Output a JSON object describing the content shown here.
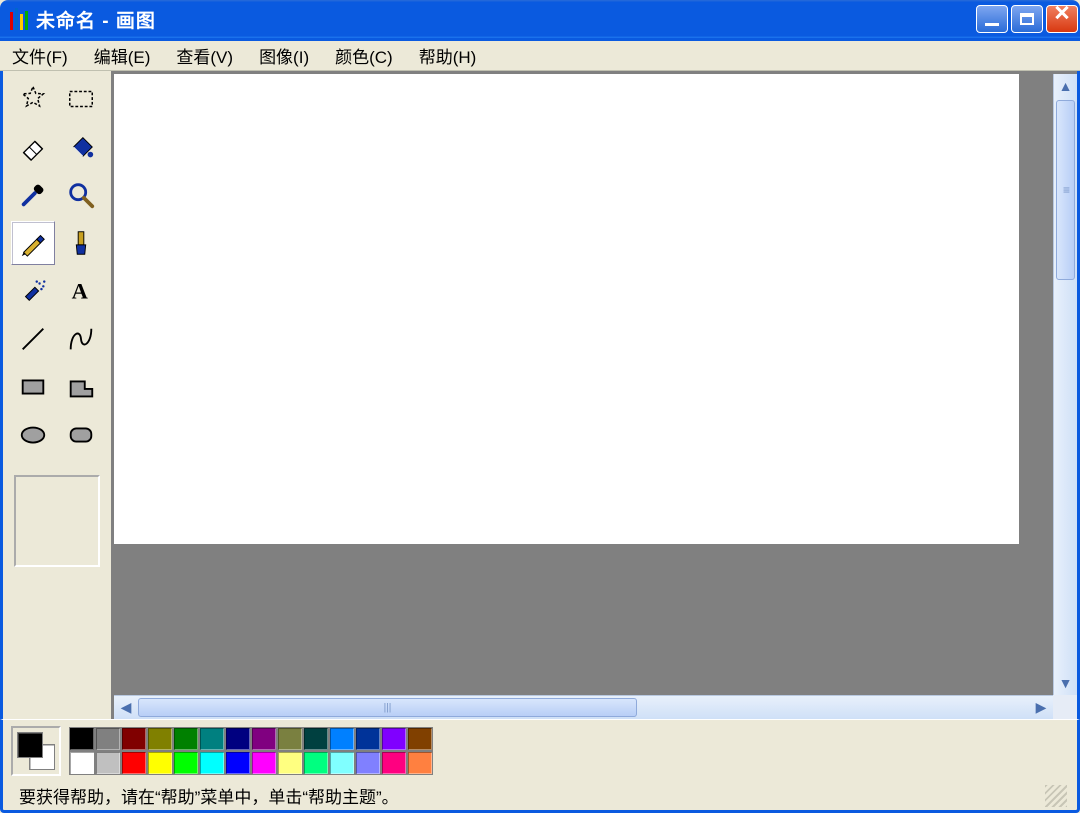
{
  "window": {
    "title": "未命名 - 画图"
  },
  "menu": {
    "file": "文件(F)",
    "edit": "编辑(E)",
    "view": "查看(V)",
    "image": "图像(I)",
    "color": "颜色(C)",
    "help": "帮助(H)"
  },
  "tools": {
    "freeform_select": "free-form-select",
    "rect_select": "rectangle-select",
    "eraser": "eraser",
    "fill": "fill-bucket",
    "picker": "color-picker",
    "magnifier": "magnifier",
    "pencil": "pencil",
    "brush": "brush",
    "airbrush": "airbrush",
    "text": "text",
    "line": "line",
    "curve": "curve",
    "rectangle": "rectangle",
    "polygon": "polygon",
    "ellipse": "ellipse",
    "rounded_rect": "rounded-rectangle",
    "selected": "pencil"
  },
  "palette": {
    "foreground": "#000000",
    "background": "#ffffff",
    "row1": [
      "#000000",
      "#808080",
      "#800000",
      "#808000",
      "#008000",
      "#008080",
      "#000080",
      "#800080",
      "#7a8040",
      "#004040",
      "#0080ff",
      "#003399",
      "#8000ff",
      "#804000"
    ],
    "row2": [
      "#ffffff",
      "#c0c0c0",
      "#ff0000",
      "#ffff00",
      "#00ff00",
      "#00ffff",
      "#0000ff",
      "#ff00ff",
      "#ffff80",
      "#00ff80",
      "#80ffff",
      "#8080ff",
      "#ff0080",
      "#ff8040"
    ]
  },
  "status": {
    "text": "要获得帮助，请在“帮助”菜单中，单击“帮助主题”。"
  }
}
